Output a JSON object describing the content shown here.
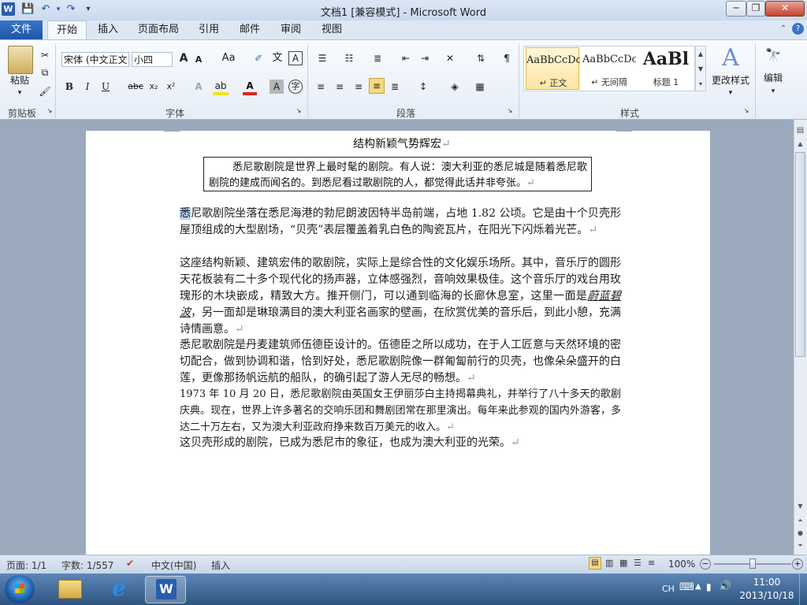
{
  "window": {
    "title": "文档1 [兼容模式] - Microsoft Word",
    "app_icon": "W",
    "controls": {
      "minimize": "─",
      "restore": "❐",
      "close": "✕"
    }
  },
  "quick_access": {
    "save": "💾",
    "undo": "↶",
    "redo": "↷",
    "customize": "▾"
  },
  "tabs": [
    {
      "label": "文件"
    },
    {
      "label": "开始"
    },
    {
      "label": "插入"
    },
    {
      "label": "页面布局"
    },
    {
      "label": "引用"
    },
    {
      "label": "邮件"
    },
    {
      "label": "审阅"
    },
    {
      "label": "视图"
    }
  ],
  "ribbon": {
    "clipboard": {
      "paste_label": "粘贴",
      "group_label": "剪贴板"
    },
    "font": {
      "font_name": "宋体 (中文正文",
      "font_size": "小四",
      "group_label": "字体",
      "bold": "B",
      "italic": "I",
      "underline": "U",
      "strike": "abc",
      "subscript": "x₂",
      "superscript": "x²",
      "grow": "A",
      "shrink": "A",
      "change_case": "Aa",
      "clear": "A",
      "font_color": "A",
      "char_border": "A",
      "char_shade": "A",
      "enclose": "字"
    },
    "paragraph": {
      "group_label": "段落"
    },
    "styles": {
      "group_label": "样式",
      "items": [
        {
          "sample": "AaBbCcDc",
          "name": "↵ 正文"
        },
        {
          "sample": "AaBbCcDc",
          "name": "↵ 无间隔"
        },
        {
          "sample": "AaBl",
          "name": "标题 1"
        }
      ],
      "change_styles": "更改样式"
    },
    "editing": {
      "label": "编辑"
    }
  },
  "document": {
    "heading": "结构新颖气势辉宏",
    "boxed_text": "悉尼歌剧院是世界上最时髦的剧院。有人说：澳大利亚的悉尼城是随着悉尼歌剧院的建成而闻名的。到悉尼看过歌剧院的人，都觉得此话并非夸张。",
    "paragraphs": [
      "悉尼歌剧院坐落在悉尼海港的勃尼朗波因特半岛前端，占地 1.82 公顷。它是由十个贝壳形屋顶组成的大型剧场，“贝壳”表层覆盖着乳白色的陶瓷瓦片，在阳光下闪烁着光芒。",
      "这座结构新颖、建筑宏伟的歌剧院，实际上是综合性的文化娱乐场所。其中，音乐厅的圆形天花板装有二十多个现代化的扬声器，立体感强烈，音响效果极佳。这个音乐厅的戏台用玫瑰形的木块嵌成，精致大方。推开侧门，可以通到临海的长廊休息室，这里一面是",
      "，另一面却是琳琅满目的澳大利亚名画家的壁画，在欣赏优美的音乐后，到此小憩，充满诗情画意。",
      "悉尼歌剧院是丹麦建筑师伍德臣设计的。伍德臣之所以成功，在于人工匠意与天然环境的密切配合，做到协调和谐，恰到好处，悉尼歌剧院像一群匍匐前行的贝壳，也像朵朵盛开的白莲，更像那扬帆远航的船队，的确引起了游人无尽的畅想。",
      "1973 年 10 月 20 日，悉尼歌剧院由英国女王伊丽莎白主持揭幕典礼，并举行了八十多天的歌剧庆典。现在，世界上许多著名的交响乐团和舞剧团常在那里演出。每年来此参观的国内外游客，多达二十万左右，又为澳大利亚政府挣来数百万美元的收入。",
      "这贝壳形成的剧院，已成为悉尼市的象征，也成为澳大利亚的光荣。"
    ],
    "italic_phrase": "蔚蓝碧波",
    "selected_char": "悉",
    "para_mark": "↵"
  },
  "status": {
    "page": "页面: 1/1",
    "words": "字数: 1/557",
    "language": "中文(中国)",
    "insert_mode": "插入",
    "zoom": "100%",
    "zoom_level": 1.0
  },
  "taskbar": {
    "ime": "CH",
    "time": "11:00",
    "date": "2013/10/18"
  },
  "colors": {
    "accent": "#2a5cb1",
    "file_tab": "#1d56a8",
    "selection": "#b9d0f0"
  }
}
